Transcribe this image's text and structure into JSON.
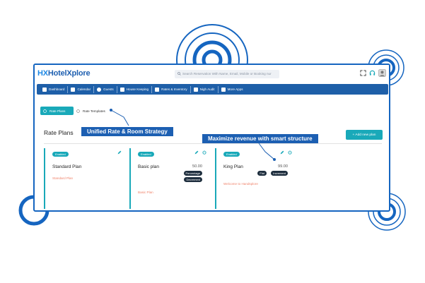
{
  "app": {
    "logo_mark": "HX",
    "logo_text": "HotelXplore",
    "search_placeholder": "Search Reservation With Name, Email, Mobile or Booking nur"
  },
  "nav": [
    {
      "label": "Dashboard"
    },
    {
      "label": "Calendar"
    },
    {
      "label": "Guests"
    },
    {
      "label": "House Keeping"
    },
    {
      "label": "Rates & Inventory"
    },
    {
      "label": "Nigh Audit"
    },
    {
      "label": "More Apps"
    }
  ],
  "tabs": {
    "rate_plans": "Rate Plans",
    "rate_templates": "Rate Templates"
  },
  "page": {
    "title": "Rate Plans",
    "add_button": "+ Add new plan"
  },
  "cards": [
    {
      "status": "Enabled",
      "name": "Standard Plan",
      "subtitle": "Standard Plan",
      "price": "",
      "tags": []
    },
    {
      "status": "Enabled",
      "name": "Basic plan",
      "subtitle": "Basic Plan",
      "price": "50.00",
      "tags": [
        "Percentage",
        "Decrement"
      ]
    },
    {
      "status": "Enabled",
      "name": "King Plan",
      "subtitle": "Welcome to Handsplore",
      "price": "99.00",
      "tags": [
        "Flat",
        "Increment"
      ]
    }
  ],
  "callouts": {
    "one": "Unified Rate & Room Strategy",
    "two": "Maximize revenue with smart structure"
  },
  "colors": {
    "brand_blue": "#1e5fa8",
    "accent_teal": "#19a9b9",
    "callout_blue": "#1c5fb2",
    "subtitle_orange": "#f0836b"
  }
}
